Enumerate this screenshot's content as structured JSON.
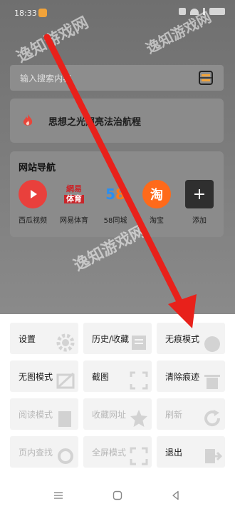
{
  "status_bar": {
    "time": "18:33"
  },
  "search": {
    "placeholder": "输入搜索内容"
  },
  "news": {
    "title": "思想之光照亮法治航程"
  },
  "site_nav": {
    "title": "网站导航",
    "items": [
      {
        "label": "西瓜视频",
        "logo": "▶",
        "color": "#e9403c"
      },
      {
        "label": "网易体育",
        "logo": "網易\n体育",
        "color": "#c8252a"
      },
      {
        "label": "58同城",
        "logo": "58",
        "color": "#ff7a1a"
      },
      {
        "label": "淘宝",
        "logo": "淘",
        "color": "#ff5000"
      },
      {
        "label": "添加",
        "logo": "+",
        "color": "#2f2f2f"
      }
    ]
  },
  "menu": {
    "items": [
      {
        "label": "设置",
        "enabled": true,
        "icon": "gear-icon"
      },
      {
        "label": "历史/收藏",
        "enabled": true,
        "icon": "history-icon"
      },
      {
        "label": "无痕模式",
        "enabled": true,
        "icon": "incognito-icon"
      },
      {
        "label": "无图模式",
        "enabled": true,
        "icon": "no-image-icon"
      },
      {
        "label": "截图",
        "enabled": true,
        "icon": "screenshot-icon"
      },
      {
        "label": "清除痕迹",
        "enabled": true,
        "icon": "clear-icon"
      },
      {
        "label": "阅读模式",
        "enabled": false,
        "icon": "reading-icon"
      },
      {
        "label": "收藏网址",
        "enabled": false,
        "icon": "star-icon"
      },
      {
        "label": "刷新",
        "enabled": false,
        "icon": "refresh-icon"
      },
      {
        "label": "页内查找",
        "enabled": false,
        "icon": "find-icon"
      },
      {
        "label": "全屏模式",
        "enabled": false,
        "icon": "fullscreen-icon"
      },
      {
        "label": "退出",
        "enabled": true,
        "icon": "exit-icon"
      }
    ]
  },
  "watermark": {
    "text": "逸知游戏网"
  },
  "colors": {
    "arrow": "#e8211b",
    "sheet_bg": "#ffffff",
    "tile_bg": "#f3f3f3"
  }
}
